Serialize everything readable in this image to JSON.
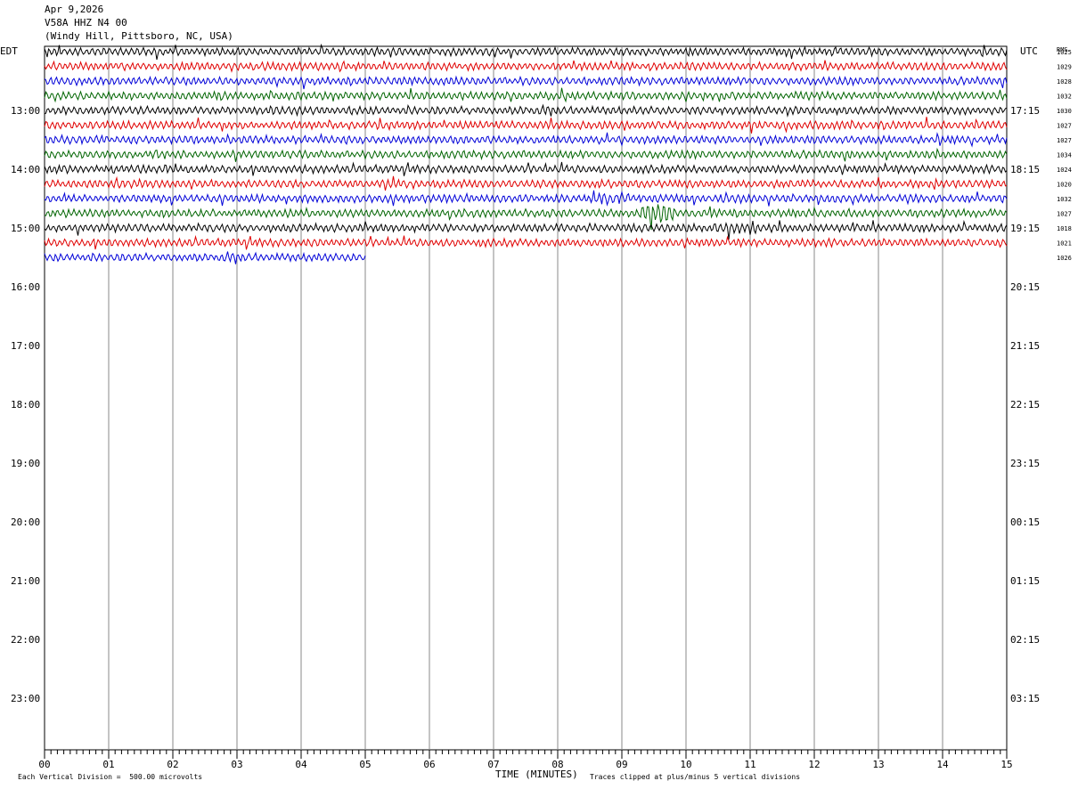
{
  "header": {
    "date": "Apr 9,2026",
    "station": "V58A HHZ N4 00",
    "location": "(Windy Hill, Pittsboro, NC, USA)"
  },
  "chart_data": {
    "type": "line",
    "left_timezone": "EDT",
    "right_timezone": "UTC",
    "rms_header": "RMS",
    "xlabel": "TIME (MINUTES)",
    "xlim": [
      0,
      15
    ],
    "x_ticks": [
      "00",
      "01",
      "02",
      "03",
      "04",
      "05",
      "06",
      "07",
      "08",
      "09",
      "10",
      "11",
      "12",
      "13",
      "14",
      "15"
    ],
    "left_hour_labels": [
      "13:00",
      "14:00",
      "15:00",
      "16:00",
      "17:00",
      "18:00",
      "19:00",
      "20:00",
      "21:00",
      "22:00",
      "23:00"
    ],
    "right_hour_labels": [
      "17:15",
      "18:15",
      "19:15",
      "20:15",
      "21:15",
      "22:15",
      "23:15",
      "00:15",
      "01:15",
      "02:15",
      "03:15"
    ],
    "trace_colors": [
      "#000000",
      "#e00000",
      "#0000d8",
      "#006400"
    ],
    "traces": [
      {
        "rms": "1025",
        "minutes": 15
      },
      {
        "rms": "1029",
        "minutes": 15
      },
      {
        "rms": "1028",
        "minutes": 15
      },
      {
        "rms": "1032",
        "minutes": 15
      },
      {
        "rms": "1030",
        "minutes": 15
      },
      {
        "rms": "1027",
        "minutes": 15
      },
      {
        "rms": "1027",
        "minutes": 15
      },
      {
        "rms": "1034",
        "minutes": 15
      },
      {
        "rms": "1024",
        "minutes": 15
      },
      {
        "rms": "1020",
        "minutes": 15
      },
      {
        "rms": "1032",
        "minutes": 15
      },
      {
        "rms": "1027",
        "minutes": 15
      },
      {
        "rms": "1018",
        "minutes": 15
      },
      {
        "rms": "1021",
        "minutes": 15
      },
      {
        "rms": "1026",
        "minutes": 5
      }
    ],
    "scale_note": "Each Vertical Division =  500.00 microvolts",
    "clip_note": "Traces clipped at plus/minus 5 vertical divisions"
  }
}
